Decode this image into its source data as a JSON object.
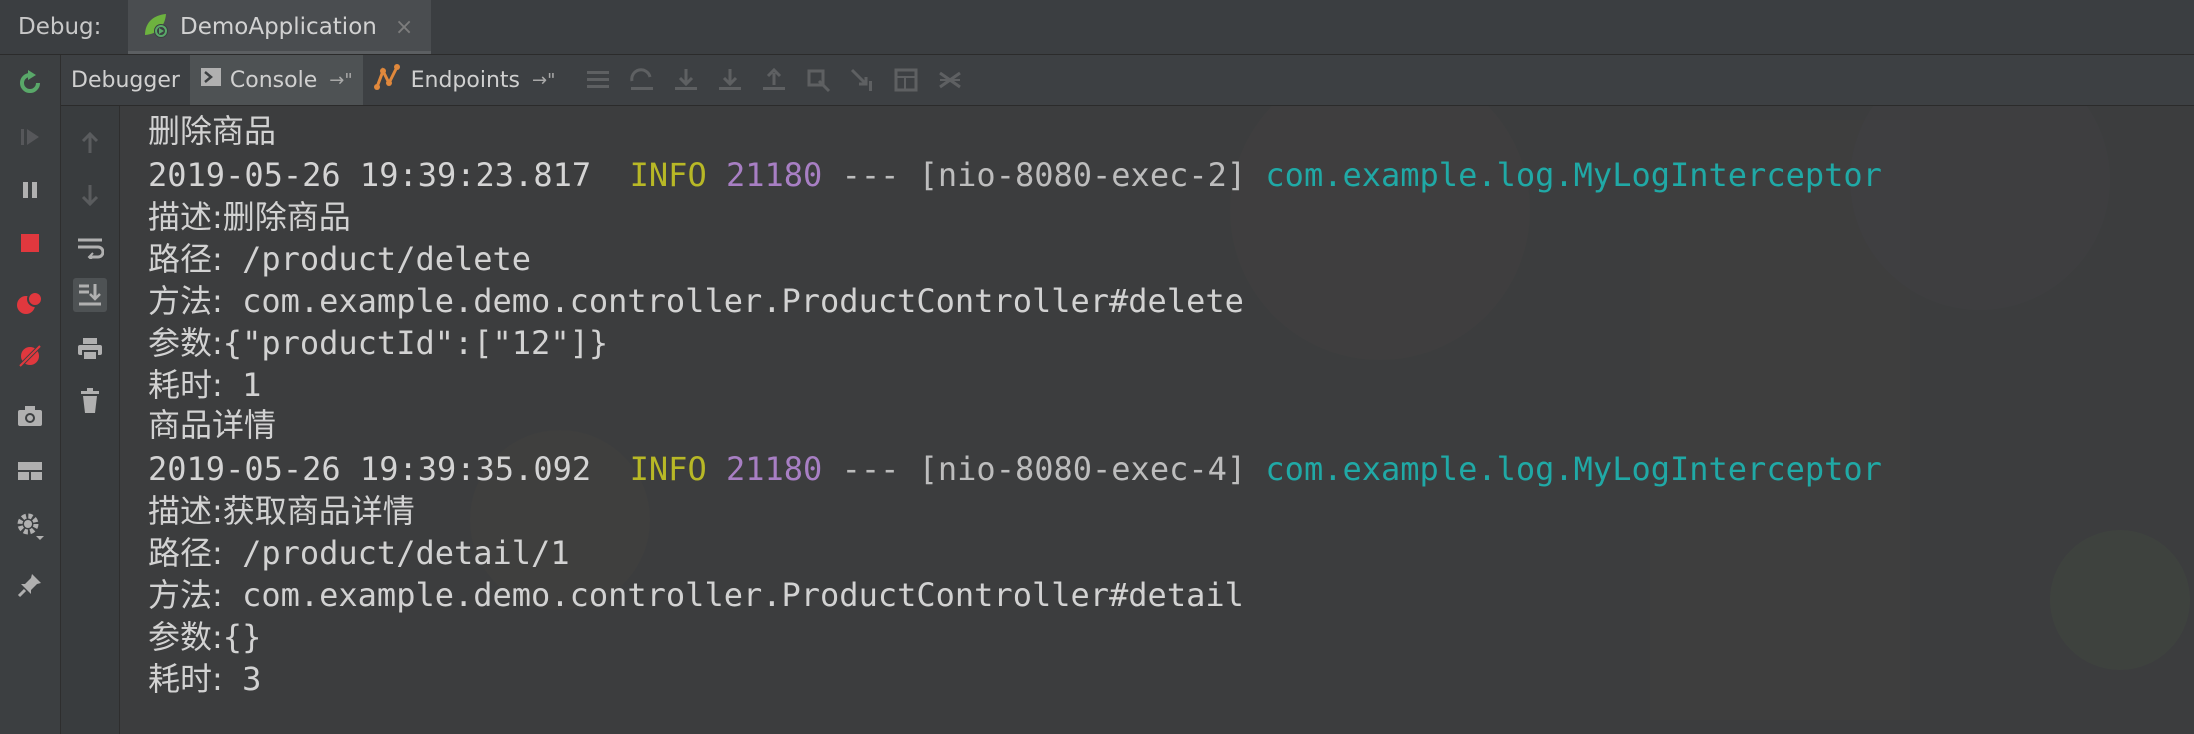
{
  "titlebar": {
    "label": "Debug:",
    "run_tab": "DemoApplication",
    "close": "×"
  },
  "tool_tabs": {
    "debugger": "Debugger",
    "console": "Console",
    "console_pin": "→\"",
    "endpoints": "Endpoints",
    "endpoints_pin": "→\""
  },
  "icons": {
    "left_toolbar": [
      "rerun-icon",
      "resume-icon",
      "pause-icon",
      "stop-icon",
      "view-breakpoints-icon",
      "mute-breakpoints-icon",
      "camera-icon",
      "layout-icon",
      "settings-icon",
      "pin-icon"
    ],
    "secondary_toolbar": [
      "scroll-up-icon",
      "scroll-down-icon",
      "soft-wrap-icon",
      "scroll-to-end-icon",
      "print-icon",
      "clear-icon"
    ],
    "colors": {
      "info": "#b8b826",
      "pid": "#a87fc4",
      "logger": "#20a9a6",
      "stop": "#e0383e",
      "rerun": "#59a869"
    }
  },
  "console": {
    "lines": [
      {
        "kind": "cn",
        "text": "删除商品"
      },
      {
        "kind": "log",
        "timestamp": "2019-05-26 19:39:23.817",
        "level": "INFO",
        "pid": "21180",
        "sep": "---",
        "thread": "[nio-8080-exec-2]",
        "logger": "com.example.log.MyLogInterceptor"
      },
      {
        "kind": "kv",
        "key": "描述:",
        "value": "删除商品"
      },
      {
        "kind": "kv",
        "key": "路径:",
        "value": "/product/delete"
      },
      {
        "kind": "kv",
        "key": "方法:",
        "value": "com.example.demo.controller.ProductController#delete"
      },
      {
        "kind": "kv",
        "key": "参数:",
        "value": "{\"productId\":[\"12\"]}"
      },
      {
        "kind": "kv",
        "key": "耗时:",
        "value": "1"
      },
      {
        "kind": "cn",
        "text": "商品详情"
      },
      {
        "kind": "log",
        "timestamp": "2019-05-26 19:39:35.092",
        "level": "INFO",
        "pid": "21180",
        "sep": "---",
        "thread": "[nio-8080-exec-4]",
        "logger": "com.example.log.MyLogInterceptor"
      },
      {
        "kind": "kv",
        "key": "描述:",
        "value": "获取商品详情"
      },
      {
        "kind": "kv",
        "key": "路径:",
        "value": "/product/detail/1"
      },
      {
        "kind": "kv",
        "key": "方法:",
        "value": "com.example.demo.controller.ProductController#detail"
      },
      {
        "kind": "kv",
        "key": "参数:",
        "value": "{}"
      },
      {
        "kind": "kv",
        "key": "耗时:",
        "value": "3"
      }
    ]
  }
}
